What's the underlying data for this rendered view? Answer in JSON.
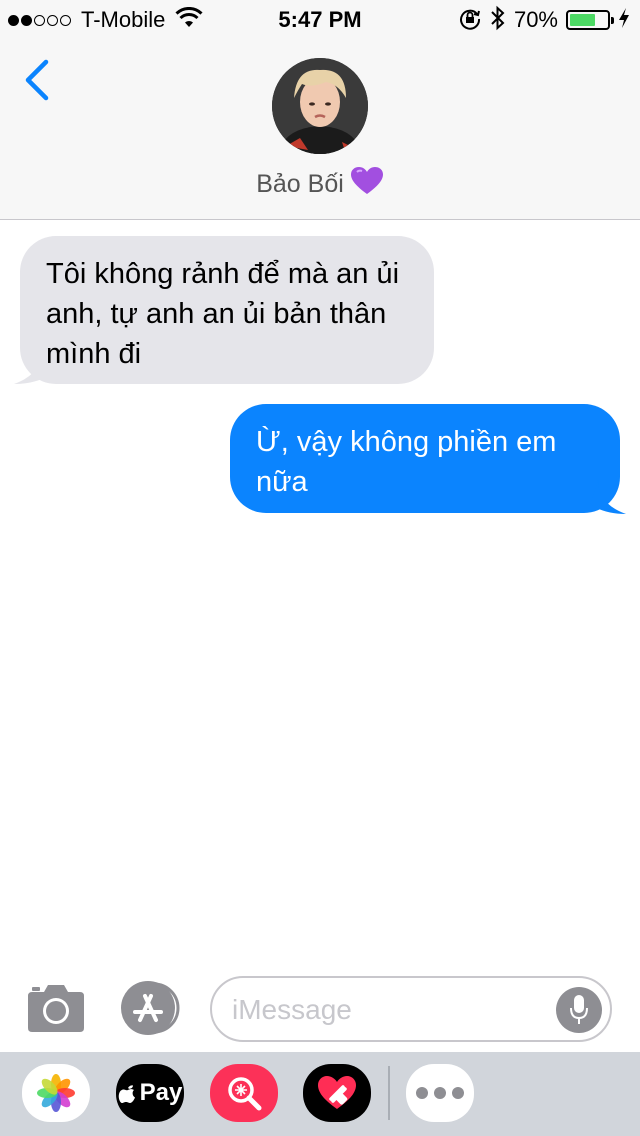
{
  "status_bar": {
    "signal_filled": 2,
    "signal_total": 5,
    "carrier": "T-Mobile",
    "time": "5:47 PM",
    "battery_percent_text": "70%",
    "battery_level": 0.7,
    "icons": [
      "wifi-icon",
      "orientation-lock-icon",
      "bluetooth-icon",
      "charging-bolt-icon"
    ]
  },
  "header": {
    "back_icon": "chevron-left-icon",
    "contact_name": "Bảo Bối",
    "contact_emoji": "💜"
  },
  "messages": [
    {
      "direction": "incoming",
      "text": "Tôi không rảnh để mà an ủi anh, tự anh an ủi bản thân mình đi"
    },
    {
      "direction": "outgoing",
      "text": "Ừ, vậy không phiền em nữa"
    }
  ],
  "composer": {
    "placeholder": "iMessage",
    "value": ""
  },
  "app_drawer": {
    "apple_pay_label": "Pay",
    "apps": [
      "photos-app-icon",
      "apple-pay-icon",
      "image-search-app-icon",
      "digital-touch-icon",
      "more-apps-icon"
    ]
  },
  "colors": {
    "accent": "#0b84fe",
    "incoming_bubble": "#e5e5ea",
    "battery_fill": "#4cd964",
    "drawer_bg": "#d1d5db"
  }
}
